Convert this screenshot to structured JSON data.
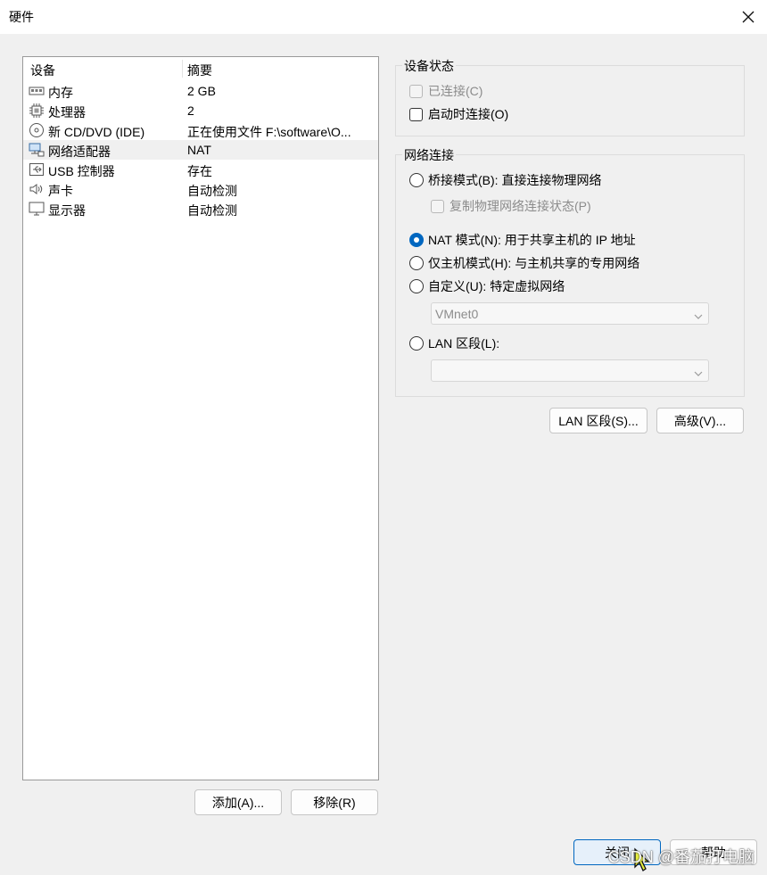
{
  "window": {
    "title": "硬件"
  },
  "device_list": {
    "columns": [
      "设备",
      "摘要"
    ],
    "items": [
      {
        "icon": "memory-icon",
        "name": "内存",
        "summary": "2 GB"
      },
      {
        "icon": "processor-icon",
        "name": "处理器",
        "summary": "2"
      },
      {
        "icon": "cd-dvd-icon",
        "name": "新 CD/DVD (IDE)",
        "summary": "正在使用文件 F:\\software\\O..."
      },
      {
        "icon": "network-adapter-icon",
        "name": "网络适配器",
        "summary": "NAT",
        "selected": true
      },
      {
        "icon": "usb-icon",
        "name": "USB 控制器",
        "summary": "存在"
      },
      {
        "icon": "speaker-icon",
        "name": "声卡",
        "summary": "自动检测"
      },
      {
        "icon": "monitor-icon",
        "name": "显示器",
        "summary": "自动检测"
      }
    ],
    "add_label": "添加(A)...",
    "remove_label": "移除(R)"
  },
  "device_status": {
    "label": "设备状态",
    "connected_label": "已连接(C)",
    "connected_checked": false,
    "connected_enabled": false,
    "connect_on_start_label": "启动时连接(O)",
    "connect_on_start_checked": false
  },
  "network": {
    "label": "网络连接",
    "bridged_label": "桥接模式(B): 直接连接物理网络",
    "replicate_label": "复制物理网络连接状态(P)",
    "nat_label": "NAT 模式(N): 用于共享主机的 IP 地址",
    "hostonly_label": "仅主机模式(H): 与主机共享的专用网络",
    "custom_label": "自定义(U): 特定虚拟网络",
    "custom_select": "VMnet0",
    "lan_label": "LAN 区段(L):",
    "lan_select": "",
    "selected": "nat"
  },
  "buttons": {
    "lan_segments": "LAN 区段(S)...",
    "advanced": "高级(V)...",
    "close": "关闭",
    "help": "帮助"
  },
  "watermark": "CSDN @番茄打电脑",
  "colors": {
    "accent": "#0067c0",
    "selected_row": "#f0f0f0"
  }
}
